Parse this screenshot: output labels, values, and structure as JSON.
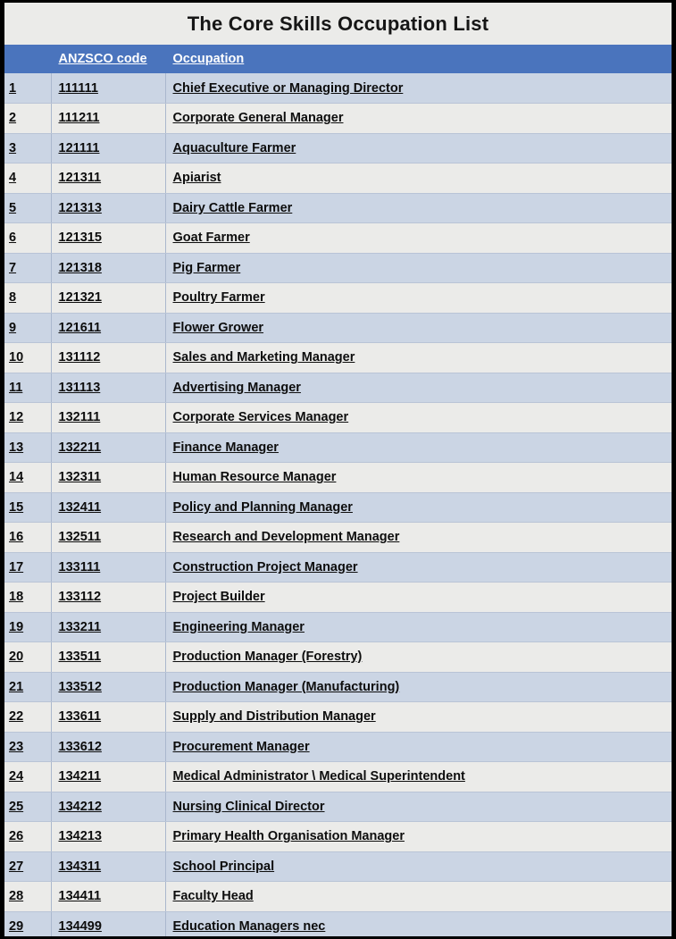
{
  "document": {
    "title": "The Core Skills Occupation List"
  },
  "table": {
    "columns": [
      {
        "key": "index",
        "label": ""
      },
      {
        "key": "code",
        "label": "ANZSCO code"
      },
      {
        "key": "occupation",
        "label": "Occupation"
      }
    ],
    "rows": [
      {
        "index": "1",
        "code": "111111",
        "occupation": "Chief Executive or Managing Director"
      },
      {
        "index": "2",
        "code": "111211",
        "occupation": "Corporate General Manager"
      },
      {
        "index": "3",
        "code": "121111",
        "occupation": "Aquaculture Farmer"
      },
      {
        "index": "4",
        "code": "121311",
        "occupation": "Apiarist"
      },
      {
        "index": "5",
        "code": "121313",
        "occupation": "Dairy Cattle Farmer"
      },
      {
        "index": "6",
        "code": "121315",
        "occupation": "Goat Farmer"
      },
      {
        "index": "7",
        "code": "121318",
        "occupation": "Pig Farmer"
      },
      {
        "index": "8",
        "code": "121321",
        "occupation": "Poultry Farmer"
      },
      {
        "index": "9",
        "code": "121611",
        "occupation": "Flower Grower"
      },
      {
        "index": "10",
        "code": "131112",
        "occupation": "Sales and Marketing Manager"
      },
      {
        "index": "11",
        "code": "131113",
        "occupation": "Advertising Manager"
      },
      {
        "index": "12",
        "code": "132111",
        "occupation": "Corporate Services Manager"
      },
      {
        "index": "13",
        "code": "132211",
        "occupation": "Finance Manager"
      },
      {
        "index": "14",
        "code": "132311",
        "occupation": "Human Resource Manager"
      },
      {
        "index": "15",
        "code": "132411",
        "occupation": "Policy and Planning Manager"
      },
      {
        "index": "16",
        "code": "132511",
        "occupation": "Research and Development Manager"
      },
      {
        "index": "17",
        "code": "133111",
        "occupation": "Construction Project Manager"
      },
      {
        "index": "18",
        "code": "133112",
        "occupation": "Project Builder"
      },
      {
        "index": "19",
        "code": "133211",
        "occupation": "Engineering Manager"
      },
      {
        "index": "20",
        "code": "133511",
        "occupation": "Production Manager (Forestry)"
      },
      {
        "index": "21",
        "code": "133512",
        "occupation": "Production Manager (Manufacturing)"
      },
      {
        "index": "22",
        "code": "133611",
        "occupation": "Supply and Distribution Manager"
      },
      {
        "index": "23",
        "code": "133612",
        "occupation": "Procurement Manager"
      },
      {
        "index": "24",
        "code": "134211",
        "occupation": "Medical Administrator \\ Medical Superintendent"
      },
      {
        "index": "25",
        "code": "134212",
        "occupation": "Nursing Clinical Director"
      },
      {
        "index": "26",
        "code": "134213",
        "occupation": "Primary Health Organisation Manager"
      },
      {
        "index": "27",
        "code": "134311",
        "occupation": "School Principal"
      },
      {
        "index": "28",
        "code": "134411",
        "occupation": "Faculty Head"
      },
      {
        "index": "29",
        "code": "134499",
        "occupation": "Education Managers nec"
      }
    ]
  },
  "theme": {
    "header_background": "#4a74bd",
    "header_text": "#ffffff",
    "row_alt_a": "#cbd5e4",
    "row_alt_b": "#ebebe9",
    "title_background": "#ebebe9",
    "border": "#000000",
    "cell_text": "#0d0d0d"
  }
}
